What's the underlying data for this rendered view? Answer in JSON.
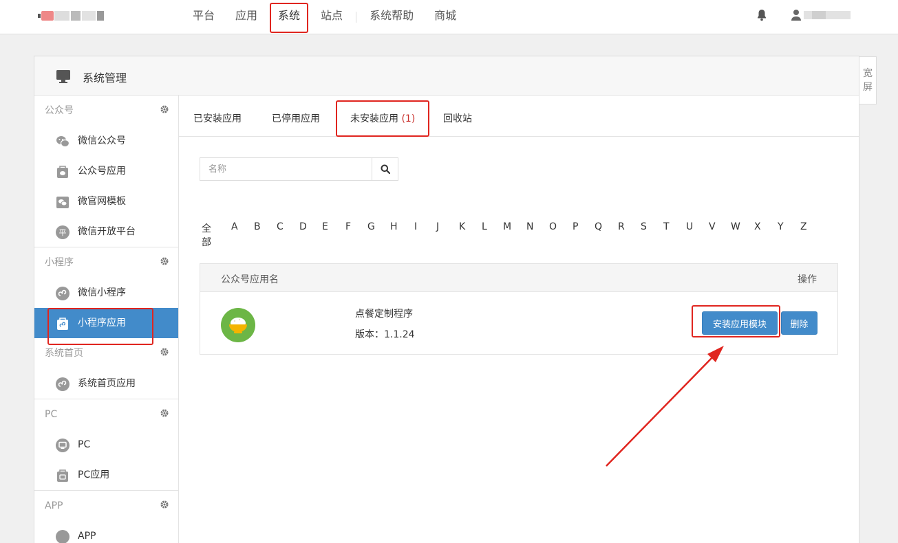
{
  "nav": {
    "items": [
      "平台",
      "应用",
      "系统",
      "站点",
      "系统帮助",
      "商城"
    ],
    "active": "系统"
  },
  "panel": {
    "title": "系统管理",
    "wide_label": "宽屏"
  },
  "sidebar": {
    "groups": [
      {
        "title": "公众号",
        "items": [
          "微信公众号",
          "公众号应用",
          "微官网模板",
          "微信开放平台"
        ]
      },
      {
        "title": "小程序",
        "items": [
          "微信小程序",
          "小程序应用"
        ]
      },
      {
        "title": "系统首页",
        "items": [
          "系统首页应用"
        ]
      },
      {
        "title": "PC",
        "items": [
          "PC",
          "PC应用"
        ]
      },
      {
        "title": "APP",
        "items": [
          "APP"
        ]
      }
    ],
    "active_item": "小程序应用"
  },
  "tabs": {
    "installed": "已安装应用",
    "disabled": "已停用应用",
    "uninstalled": "未安装应用",
    "uninstalled_count": "(1)",
    "recycle": "回收站"
  },
  "search": {
    "placeholder": "名称"
  },
  "filter": {
    "letters": [
      "全部",
      "A",
      "B",
      "C",
      "D",
      "E",
      "F",
      "G",
      "H",
      "I",
      "J",
      "K",
      "L",
      "M",
      "N",
      "O",
      "P",
      "Q",
      "R",
      "S",
      "T",
      "U",
      "V",
      "W",
      "X",
      "Y",
      "Z"
    ]
  },
  "table": {
    "col_name": "公众号应用名",
    "col_action": "操作",
    "rows": [
      {
        "name": "点餐定制程序",
        "version": "版本：1.1.24",
        "install_label": "安装应用模块",
        "delete_label": "删除"
      }
    ]
  },
  "colors": {
    "primary": "#428bca",
    "highlight": "#e0251f",
    "app_icon": "#6cb646"
  }
}
